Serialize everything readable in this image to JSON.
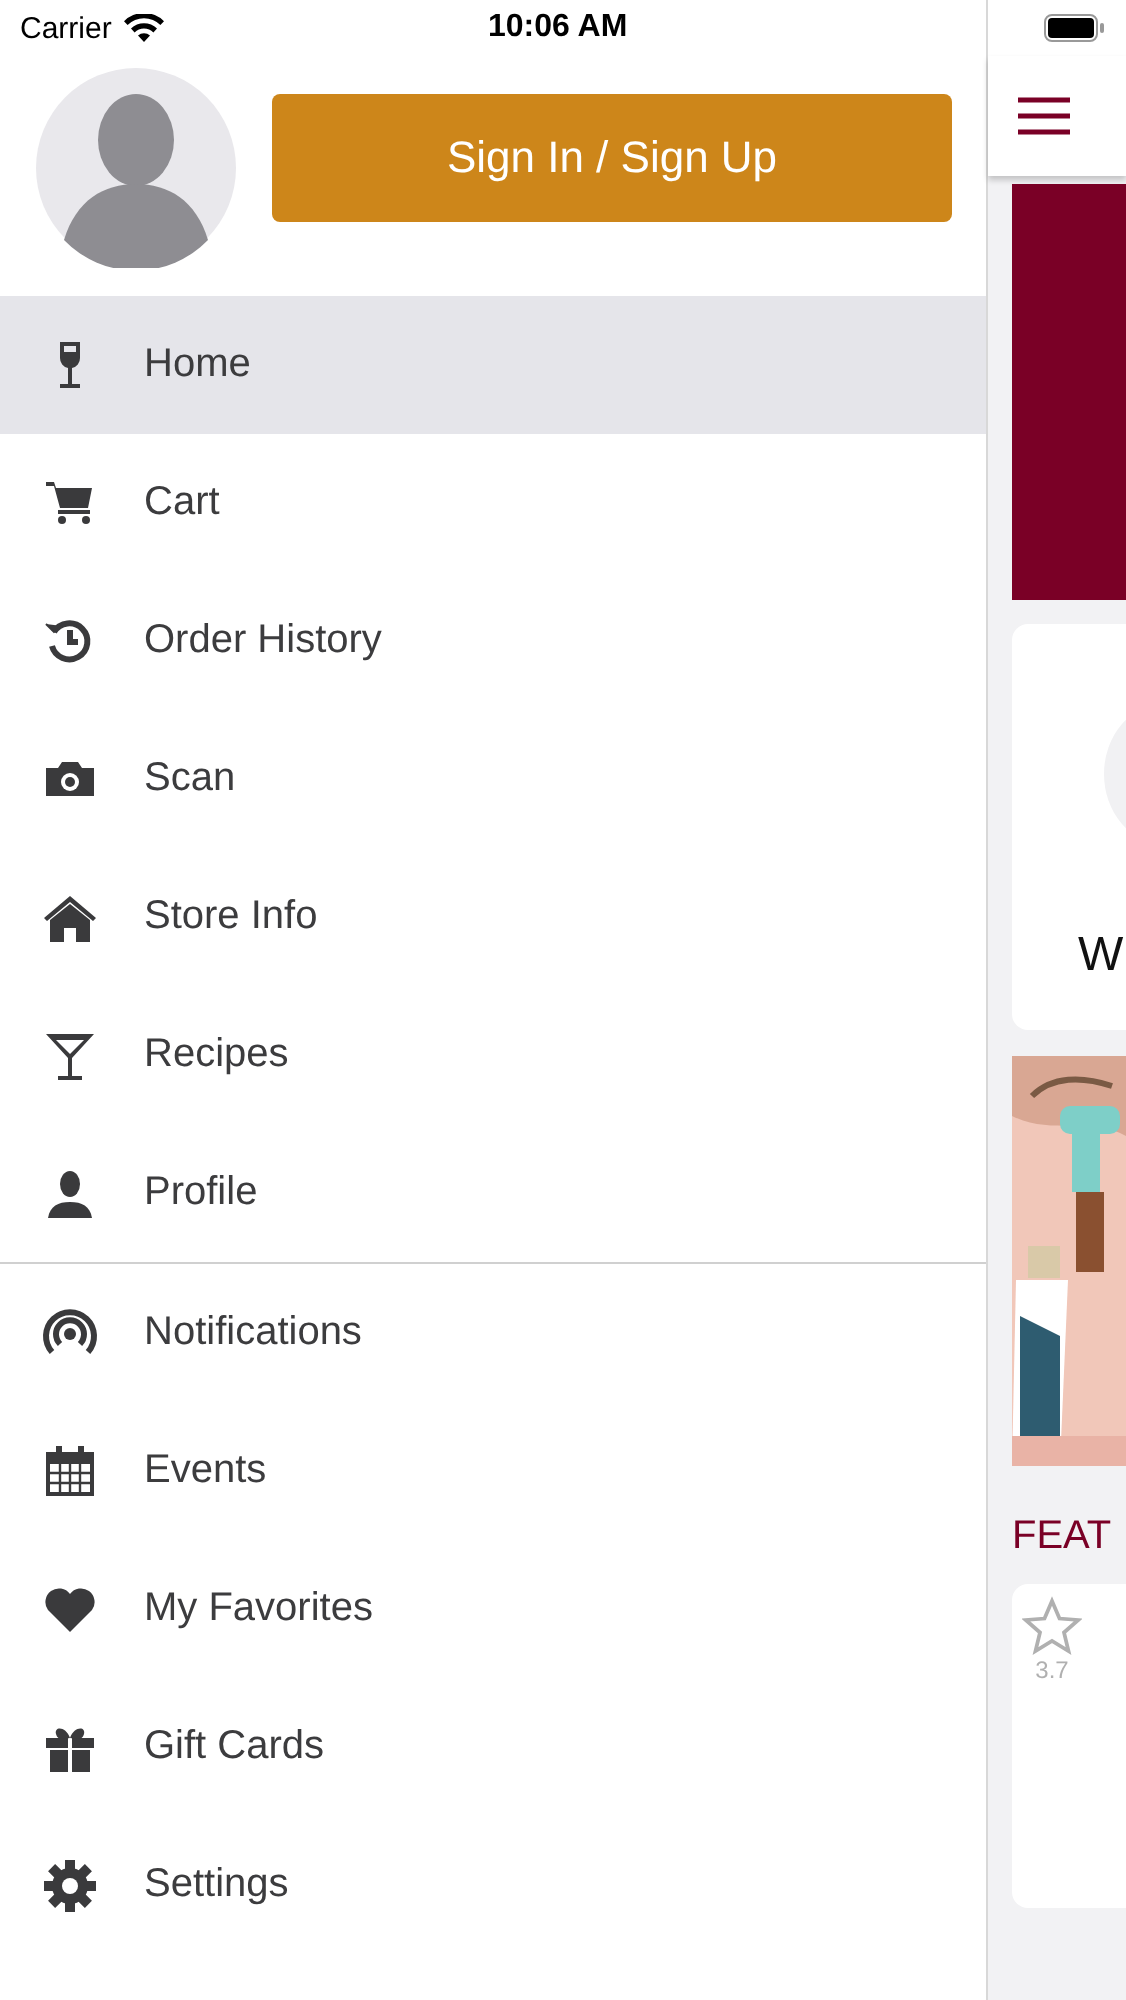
{
  "status_bar": {
    "carrier": "Carrier",
    "time": "10:06 AM"
  },
  "drawer": {
    "sign_in_button": "Sign In / Sign Up",
    "groups": [
      [
        {
          "label": "Home",
          "selected": true
        },
        {
          "label": "Cart",
          "selected": false
        },
        {
          "label": "Order History",
          "selected": false
        },
        {
          "label": "Scan",
          "selected": false
        },
        {
          "label": "Store Info",
          "selected": false
        },
        {
          "label": "Recipes",
          "selected": false
        },
        {
          "label": "Profile",
          "selected": false
        }
      ],
      [
        {
          "label": "Notifications",
          "selected": false
        },
        {
          "label": "Events",
          "selected": false
        },
        {
          "label": "My Favorites",
          "selected": false
        },
        {
          "label": "Gift Cards",
          "selected": false
        },
        {
          "label": "Settings",
          "selected": false
        }
      ]
    ]
  },
  "background_page": {
    "card_text": "W",
    "section_title": "FEAT",
    "product_rating": "3.7"
  }
}
